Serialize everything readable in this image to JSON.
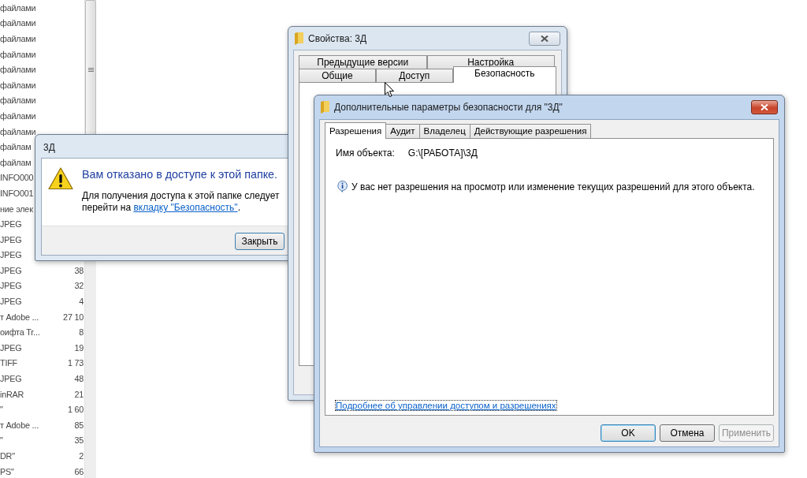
{
  "file_list": {
    "rows": [
      {
        "name": "файлами"
      },
      {
        "name": "файлами"
      },
      {
        "name": "файлами"
      },
      {
        "name": "файлами"
      },
      {
        "name": "файлами"
      },
      {
        "name": "файлами"
      },
      {
        "name": "файлами"
      },
      {
        "name": "файлами"
      },
      {
        "name": "файлами"
      },
      {
        "name": "файлам"
      },
      {
        "name": "файлам"
      },
      {
        "name": "INFO000"
      },
      {
        "name": "INFO001"
      },
      {
        "name": "ние элек"
      },
      {
        "name": "JPEG"
      },
      {
        "name": "JPEG"
      },
      {
        "name": "JPEG"
      },
      {
        "name": "JPEG",
        "size": "38"
      },
      {
        "name": "JPEG",
        "size": "32"
      },
      {
        "name": "JPEG",
        "size": "4"
      },
      {
        "name": "т Adobe ...",
        "size": "27 10"
      },
      {
        "name": "оифта Tr...",
        "size": "8"
      },
      {
        "name": "JPEG",
        "size": "19"
      },
      {
        "name": "TIFF",
        "size": "1 73"
      },
      {
        "name": "JPEG",
        "size": "48"
      },
      {
        "name": "inRAR",
        "size": "21"
      },
      {
        "name": "\"",
        "size": "1 60"
      },
      {
        "name": "т Adobe ...",
        "size": "85"
      },
      {
        "name": "\"",
        "size": "35"
      },
      {
        "name": "DR\"",
        "size": "2"
      },
      {
        "name": "PS\"",
        "size": "66"
      }
    ]
  },
  "error_dialog": {
    "title": "3Д",
    "heading": "Вам отказано в доступе к этой папке.",
    "message": "Для получения доступа к этой папке следует перейти на",
    "link": "вкладку \"Безопасность\"",
    "message_end": ".",
    "button": "Закрыть"
  },
  "properties_window": {
    "title": "Свойства: 3Д",
    "tab_rows": [
      [
        {
          "label": "Предыдущие версии",
          "selected": false
        },
        {
          "label": "Настройка",
          "selected": false
        }
      ],
      [
        {
          "label": "Общие",
          "selected": false
        },
        {
          "label": "Доступ",
          "selected": false
        },
        {
          "label": "Безопасность",
          "selected": true
        }
      ]
    ]
  },
  "security_dialog": {
    "title": "Дополнительные параметры безопасности  для \"3Д\"",
    "tabs": [
      {
        "label": "Разрешения",
        "selected": true
      },
      {
        "label": "Аудит",
        "selected": false
      },
      {
        "label": "Владелец",
        "selected": false
      },
      {
        "label": "Действующие разрешения",
        "selected": false
      }
    ],
    "object_label": "Имя объекта:",
    "object_name": "G:\\[РАБОТА]\\3Д",
    "info": "У вас нет разрешения на просмотр или изменение текущих разрешений для этого объекта.",
    "link": "Подробнее об управлении доступом и разрешениях",
    "buttons": [
      {
        "label": "OK",
        "default": true,
        "disabled": false
      },
      {
        "label": "Отмена",
        "default": false,
        "disabled": false
      },
      {
        "label": "Применить",
        "default": false,
        "disabled": true
      }
    ]
  }
}
